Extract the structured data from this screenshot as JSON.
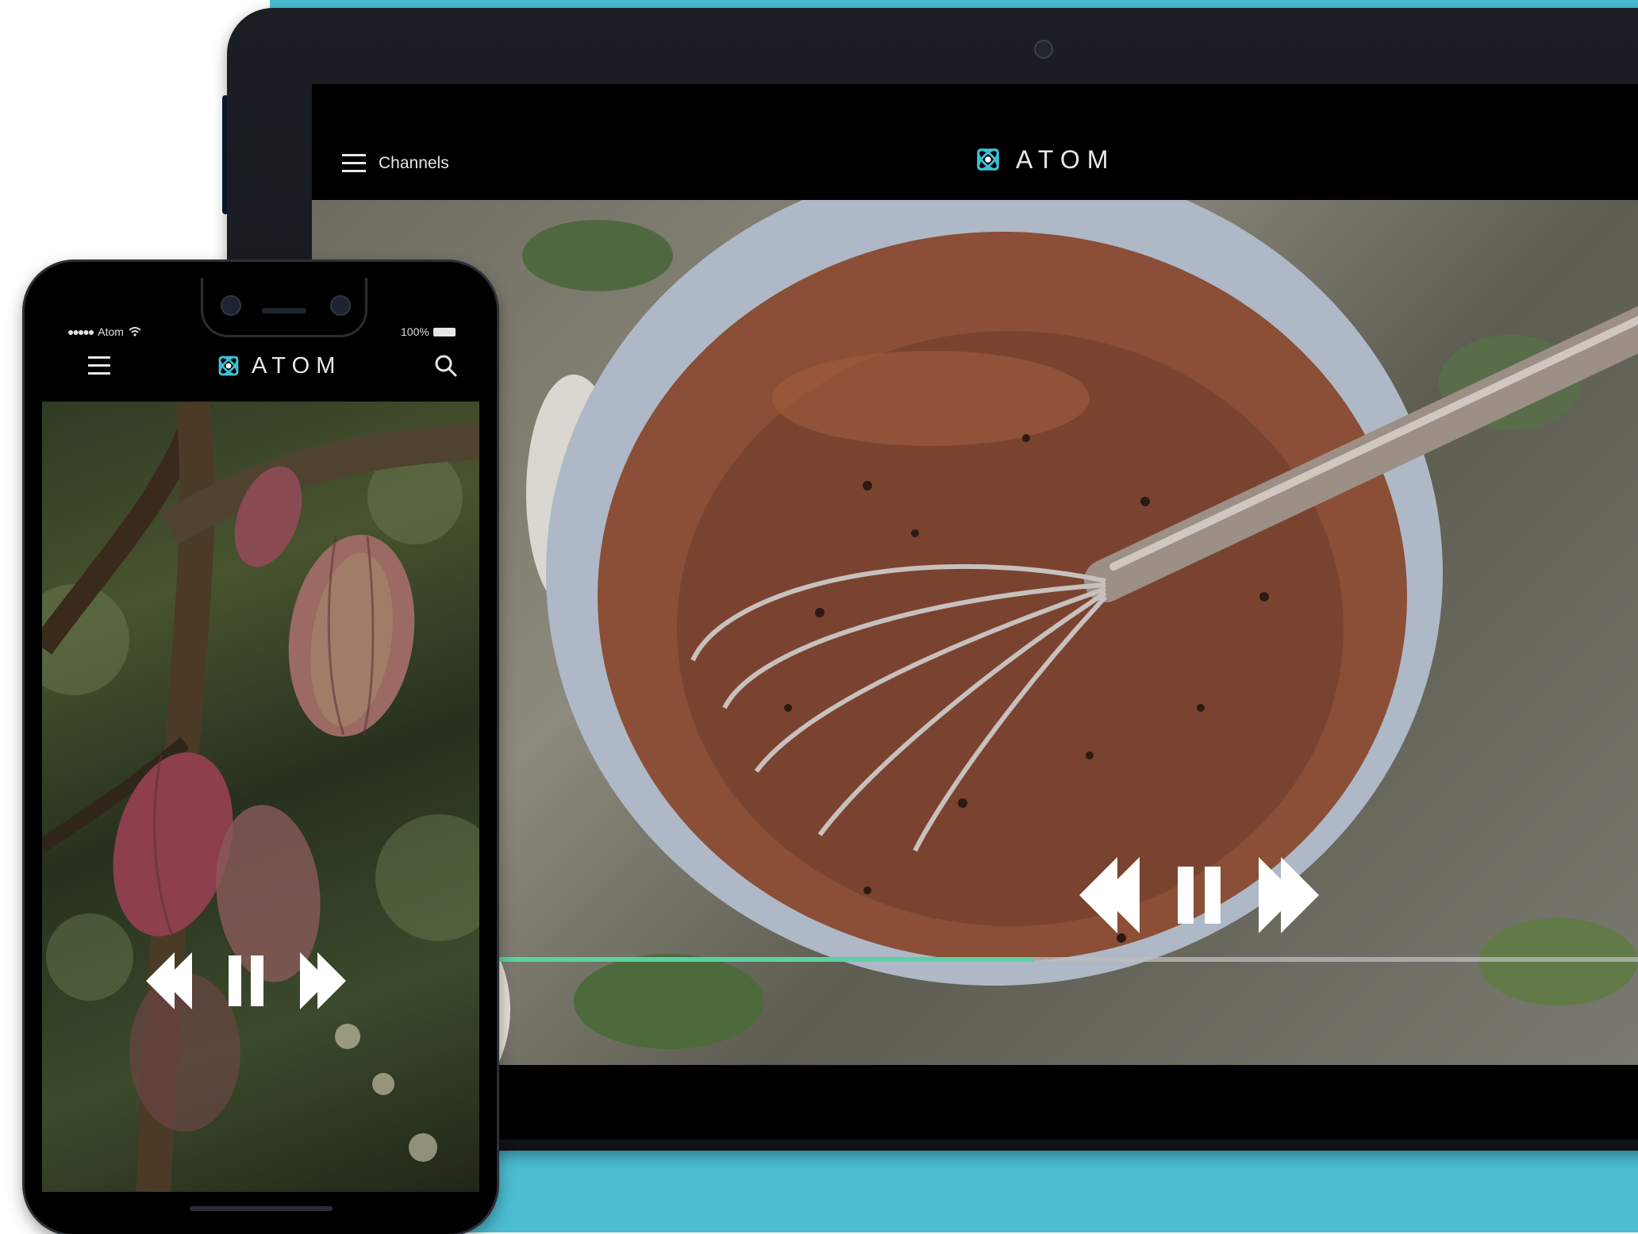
{
  "colors": {
    "background_teal": "#4bbdd3",
    "progress_fill": "#5bd0a4",
    "logo_accent": "#3ec3dc"
  },
  "tablet": {
    "header": {
      "menu_icon": "hamburger-icon",
      "channels_label": "Channels",
      "logo_icon": "atom-logo-icon",
      "logo_text": "ATOM"
    },
    "player": {
      "controls": [
        "rewind-icon",
        "pause-icon",
        "fast-forward-icon"
      ],
      "progress_fraction": 0.47
    }
  },
  "phone": {
    "status_bar": {
      "carrier": "Atom",
      "battery": "100%"
    },
    "header": {
      "menu_icon": "hamburger-icon",
      "logo_icon": "atom-logo-icon",
      "logo_text": "ATOM",
      "search_icon": "search-icon"
    },
    "player": {
      "controls": [
        "rewind-icon",
        "pause-icon",
        "fast-forward-icon"
      ]
    }
  }
}
